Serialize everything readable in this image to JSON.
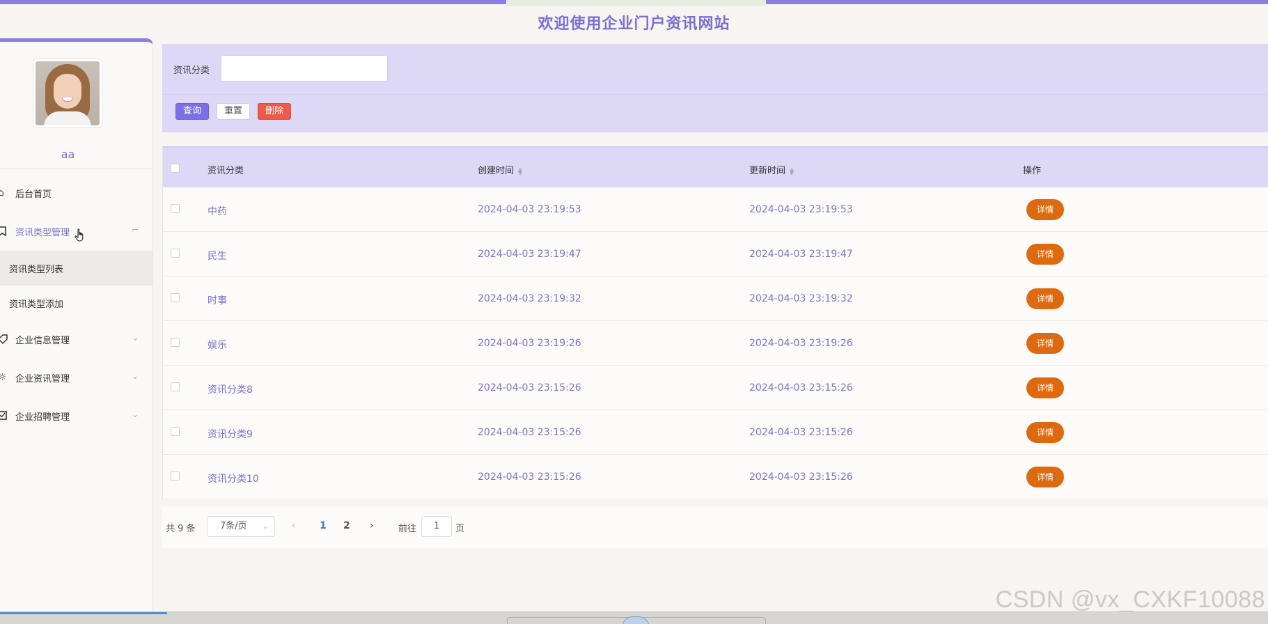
{
  "site_title": "欢迎使用企业门户资讯网站",
  "user": {
    "name": "aa"
  },
  "sidebar": {
    "menu": [
      {
        "label": "后台首页",
        "icon": "home-icon"
      },
      {
        "label": "资讯类型管理",
        "icon": "bookmark-icon",
        "active": true,
        "children": [
          {
            "label": "资讯类型列表"
          },
          {
            "label": "资讯类型添加"
          }
        ]
      },
      {
        "label": "企业信息管理",
        "icon": "tag-icon"
      },
      {
        "label": "企业资讯管理",
        "icon": "gear-icon"
      },
      {
        "label": "企业招聘管理",
        "icon": "checkbox-icon"
      }
    ]
  },
  "search": {
    "label": "资讯分类",
    "value": "",
    "buttons": {
      "query": "查询",
      "reset": "重置",
      "delete": "删除"
    }
  },
  "table": {
    "headers": {
      "category": "资讯分类",
      "created": "创建时间",
      "updated": "更新时间",
      "action": "操作"
    },
    "detail_label": "详情",
    "rows": [
      {
        "category": "中药",
        "created": "2024-04-03 23:19:53",
        "updated": "2024-04-03 23:19:53"
      },
      {
        "category": "民生",
        "created": "2024-04-03 23:19:47",
        "updated": "2024-04-03 23:19:47"
      },
      {
        "category": "时事",
        "created": "2024-04-03 23:19:32",
        "updated": "2024-04-03 23:19:32"
      },
      {
        "category": "娱乐",
        "created": "2024-04-03 23:19:26",
        "updated": "2024-04-03 23:19:26"
      },
      {
        "category": "资讯分类8",
        "created": "2024-04-03 23:15:26",
        "updated": "2024-04-03 23:15:26"
      },
      {
        "category": "资讯分类9",
        "created": "2024-04-03 23:15:26",
        "updated": "2024-04-03 23:15:26"
      },
      {
        "category": "资讯分类10",
        "created": "2024-04-03 23:15:26",
        "updated": "2024-04-03 23:15:26"
      }
    ]
  },
  "pagination": {
    "total_text": "共 9 条",
    "page_size": "7条/页",
    "pages": [
      "1",
      "2"
    ],
    "current_page": "1",
    "goto_label": "前往",
    "goto_value": "1",
    "goto_unit": "页"
  },
  "watermark": "CSDN @vx_CXKF10088",
  "colors": {
    "accent": "#7b6fd6",
    "header_bg": "#dcd8f6",
    "detail_button": "#dd6a10",
    "delete_button": "#ec5a4a"
  }
}
